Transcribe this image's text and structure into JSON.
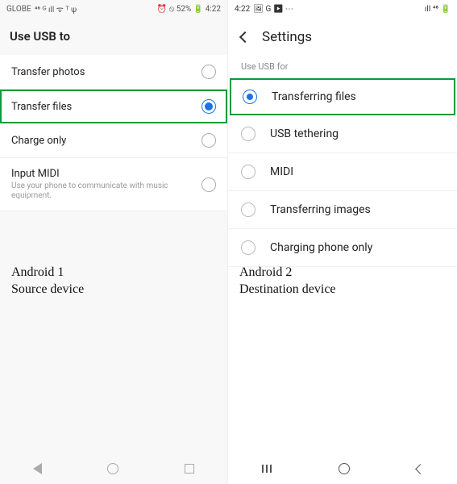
{
  "left": {
    "status": {
      "carrier": "GLOBE",
      "signals": "⁴⁶ ᴳ ıll ᯤ ᵀ ψ",
      "right_icons": "⏰ ⦸ 52% 🔋 4:22"
    },
    "title": "Use USB to",
    "options": [
      {
        "label": "Transfer photos",
        "selected": false
      },
      {
        "label": "Transfer files",
        "selected": true
      },
      {
        "label": "Charge only",
        "selected": false
      },
      {
        "label": "Input MIDI",
        "sub": "Use your phone to communicate with music equipment.",
        "selected": false
      }
    ],
    "caption_line1": "Android 1",
    "caption_line2": "Source device"
  },
  "right": {
    "status": {
      "time": "4:22",
      "left_icons": "🖼 G ▶ ⋯",
      "right_icons": "ıll ⁴⁶ 🔋"
    },
    "header": "Settings",
    "sub_header": "Use USB for",
    "options": [
      {
        "label": "Transferring files",
        "selected": true
      },
      {
        "label": "USB tethering",
        "selected": false
      },
      {
        "label": "MIDI",
        "selected": false
      },
      {
        "label": "Transferring images",
        "selected": false
      },
      {
        "label": "Charging phone only",
        "selected": false
      }
    ],
    "caption_line1": "Android 2",
    "caption_line2": "Destination device"
  }
}
